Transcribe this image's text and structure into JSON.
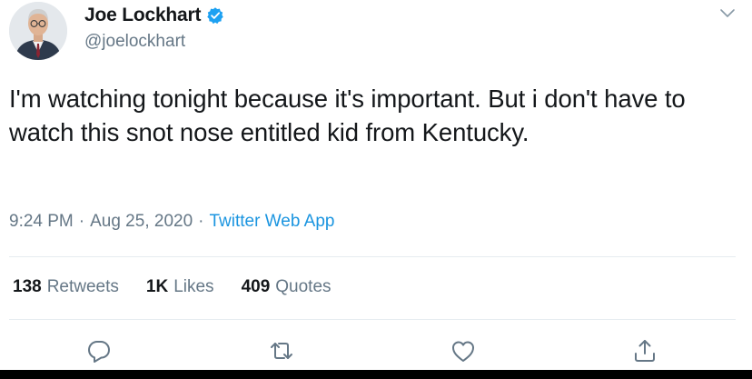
{
  "tweet": {
    "author": {
      "display_name": "Joe Lockhart",
      "handle": "@joelockhart",
      "verified": true
    },
    "text": "I'm watching tonight because it's important. But i don't have to watch this snot nose entitled kid from Kentucky.",
    "time": "9:24 PM",
    "date": "Aug 25, 2020",
    "source": "Twitter Web App",
    "separator": "·",
    "stats": {
      "retweets_count": "138",
      "retweets_label": "Retweets",
      "likes_count": "1K",
      "likes_label": "Likes",
      "quotes_count": "409",
      "quotes_label": "Quotes"
    }
  },
  "colors": {
    "text": "#14171a",
    "muted": "#657786",
    "link": "#1b95e0",
    "verified": "#1da1f2",
    "divider": "#e6ecf0"
  },
  "icons": {
    "reply": "reply-icon",
    "retweet": "retweet-icon",
    "like": "like-icon",
    "share": "share-icon",
    "caret": "chevron-down-icon",
    "verified": "verified-badge-icon"
  }
}
